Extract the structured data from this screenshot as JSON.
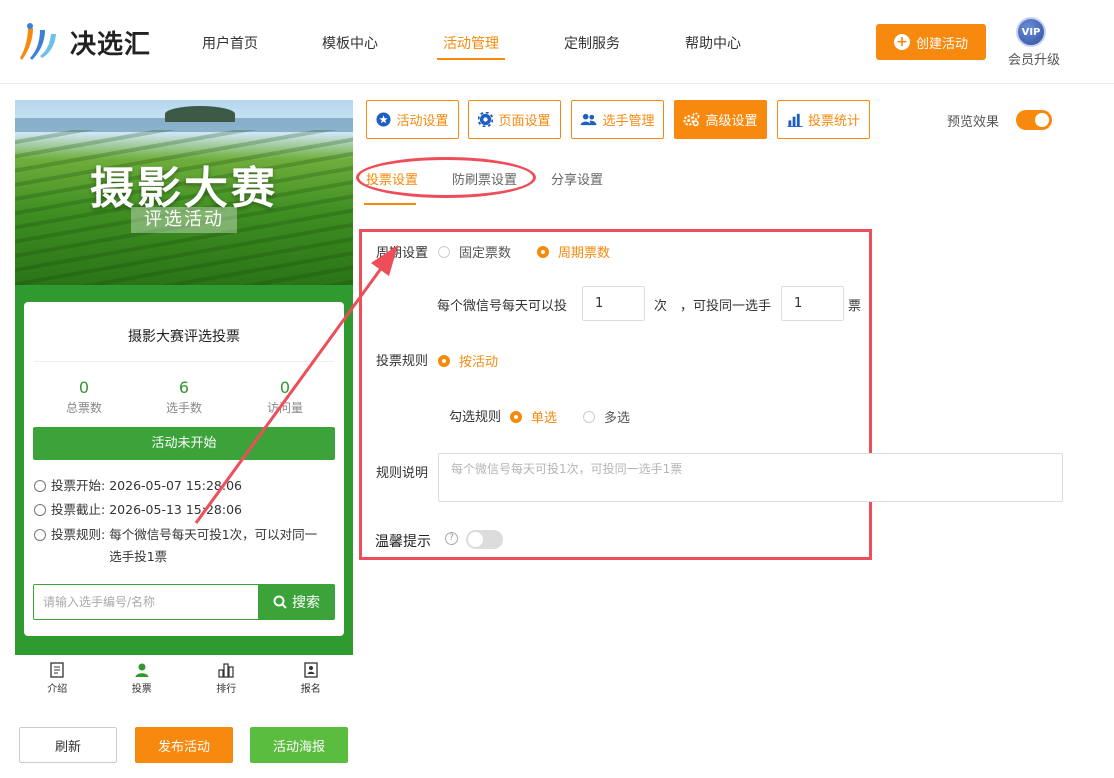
{
  "header": {
    "logo_text": "决选汇",
    "nav": [
      "用户首页",
      "模板中心",
      "活动管理",
      "定制服务",
      "帮助中心"
    ],
    "active_nav": "活动管理",
    "create_button": "创建活动",
    "vip_badge": "VIP",
    "vip_label": "会员升级"
  },
  "preview": {
    "banner_title": "摄影大赛",
    "banner_subtitle": "评选活动",
    "card_title": "摄影大赛评选投票",
    "stats": [
      {
        "value": "0",
        "label": "总票数"
      },
      {
        "value": "6",
        "label": "选手数"
      },
      {
        "value": "0",
        "label": "访问量"
      }
    ],
    "status_button": "活动未开始",
    "info": {
      "start_label": "投票开始:",
      "start_value": "2026-05-07 15:28:06",
      "end_label": "投票截止:",
      "end_value": "2026-05-13 15:28:06",
      "rule_label": "投票规则:",
      "rule_value": "每个微信号每天可投1次，可以对同一选手投1票"
    },
    "search_placeholder": "请输入选手编号/名称",
    "search_button": "搜索",
    "tabbar": [
      "介绍",
      "投票",
      "排行",
      "报名"
    ],
    "active_tab": "投票"
  },
  "bottom_buttons": {
    "refresh": "刷新",
    "publish": "发布活动",
    "poster": "活动海报"
  },
  "settings_tabs": [
    "活动设置",
    "页面设置",
    "选手管理",
    "高级设置",
    "投票统计"
  ],
  "active_settings_tab": "高级设置",
  "preview_effect_label": "预览效果",
  "sub_tabs": [
    "投票设置",
    "防刷票设置",
    "分享设置"
  ],
  "active_sub_tab": "投票设置",
  "form": {
    "cycle_label": "周期设置",
    "cycle_options": [
      "固定票数",
      "周期票数"
    ],
    "cycle_selected": "周期票数",
    "per_day_text": "每个微信号每天可以投",
    "per_day_value": "1",
    "times_unit": "次",
    "same_player_text": "，可投同一选手",
    "same_player_value": "1",
    "votes_unit": "票",
    "rule_label": "投票规则",
    "rule_option": "按活动",
    "check_rule_label": "勾选规则",
    "check_options": [
      "单选",
      "多选"
    ],
    "check_selected": "单选",
    "desc_label": "规则说明",
    "desc_placeholder": "每个微信号每天可投1次，可投同一选手1票",
    "tip_label": "温馨提示",
    "help_mark": "?"
  },
  "colors": {
    "accent": "#f7890e",
    "green": "#3ba33a",
    "annotation_red": "#ee4d5a"
  }
}
